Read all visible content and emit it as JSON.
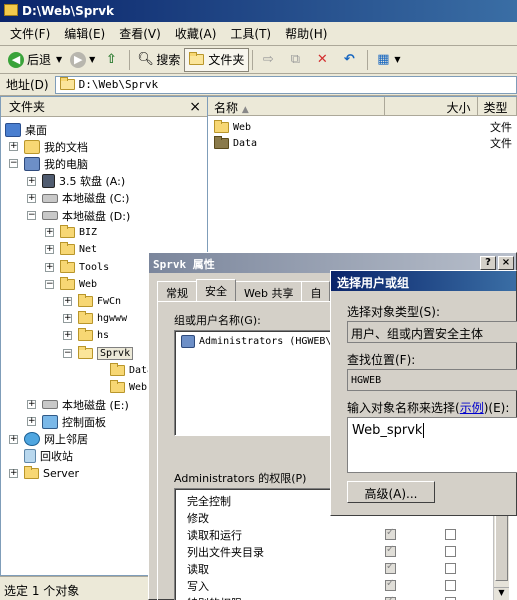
{
  "window": {
    "title": "D:\\Web\\Sprvk"
  },
  "menu": [
    "文件(F)",
    "编辑(E)",
    "查看(V)",
    "收藏(A)",
    "工具(T)",
    "帮助(H)"
  ],
  "toolbar": {
    "back": "后退",
    "search": "搜索",
    "folders": "文件夹"
  },
  "address": {
    "label": "地址(D)",
    "value": "D:\\Web\\Sprvk"
  },
  "left_pane": {
    "title": "文件夹",
    "close": "×",
    "tree": [
      {
        "label": "桌面",
        "icon": "desktop-icon"
      },
      {
        "label": "我的文档",
        "icon": "my-documents-icon",
        "exp": "+"
      },
      {
        "label": "我的电脑",
        "icon": "my-computer-icon",
        "exp": "−"
      },
      {
        "label": "3.5 软盘 (A:)",
        "icon": "floppy-drive-icon",
        "exp": "+"
      },
      {
        "label": "本地磁盘 (C:)",
        "icon": "hard-disk-icon",
        "exp": "+"
      },
      {
        "label": "本地磁盘 (D:)",
        "icon": "hard-disk-icon",
        "exp": "−"
      },
      {
        "label": "BIZ",
        "icon": "folder-icon",
        "exp": "+"
      },
      {
        "label": "Net",
        "icon": "folder-icon",
        "exp": "+"
      },
      {
        "label": "Tools",
        "icon": "folder-icon",
        "exp": "+"
      },
      {
        "label": "Web",
        "icon": "folder-icon",
        "exp": "−"
      },
      {
        "label": "FwCn",
        "icon": "folder-icon",
        "exp": "+"
      },
      {
        "label": "hgwww",
        "icon": "folder-icon",
        "exp": "+"
      },
      {
        "label": "hs",
        "icon": "folder-icon",
        "exp": "+"
      },
      {
        "label": "Sprvk",
        "icon": "open-folder-icon",
        "exp": "−"
      },
      {
        "label": "Data",
        "icon": "folder-icon"
      },
      {
        "label": "Web",
        "icon": "folder-icon"
      },
      {
        "label": "本地磁盘 (E:)",
        "icon": "hard-disk-icon",
        "exp": "+"
      },
      {
        "label": "控制面板",
        "icon": "control-panel-icon",
        "exp": "+"
      },
      {
        "label": "网上邻居",
        "icon": "network-icon",
        "exp": "+"
      },
      {
        "label": "回收站",
        "icon": "recycle-bin-icon"
      },
      {
        "label": "Server",
        "icon": "folder-icon",
        "exp": "+"
      }
    ]
  },
  "right_pane": {
    "columns": [
      "名称",
      "大小",
      "类型"
    ],
    "files": [
      {
        "name": "Web",
        "type": "文件"
      },
      {
        "name": "Data",
        "type": "文件"
      }
    ]
  },
  "status": "选定 1 个对象",
  "properties_dialog": {
    "title": "Sprvk 属性",
    "tabs": [
      "常规",
      "安全",
      "Web 共享",
      "自"
    ],
    "group_label": "组或用户名称(G):",
    "groups": [
      "Administrators (HGWEB\\"
    ],
    "perm_label": "Administrators 的权限(P)",
    "permissions": [
      "完全控制",
      "修改",
      "读取和运行",
      "列出文件夹目录",
      "读取",
      "写入",
      "特别的权限"
    ]
  },
  "select_dialog": {
    "title": "选择用户或组",
    "type_label": "选择对象类型(S):",
    "type_value": "用户、组或内置安全主体",
    "location_label": "查找位置(F):",
    "location_value": "HGWEB",
    "enter_label_pre": "输入对象名称来选择(",
    "enter_label_link": "示例",
    "enter_label_post": ")(E):",
    "enter_value": "Web_sprvk",
    "advanced_button": "高级(A)..."
  },
  "dialog_buttons": {
    "help": "?",
    "close": "×"
  }
}
